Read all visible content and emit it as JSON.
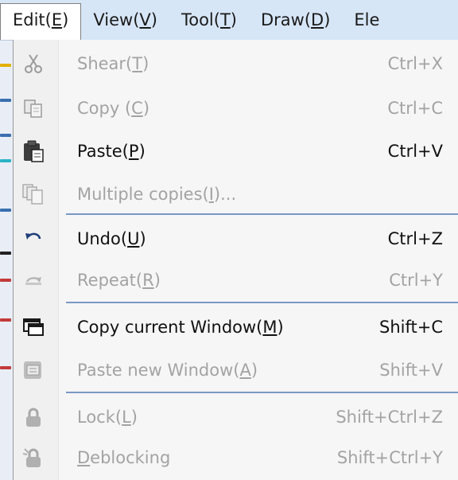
{
  "menubar": {
    "items": [
      {
        "text": "Edit(",
        "acc": "E",
        "tail": ")"
      },
      {
        "text": "View(",
        "acc": "V",
        "tail": ")"
      },
      {
        "text": "Tool(",
        "acc": "T",
        "tail": ")"
      },
      {
        "text": "Draw(",
        "acc": "D",
        "tail": ")"
      },
      {
        "text": "Ele",
        "acc": "",
        "tail": ""
      }
    ]
  },
  "menu": {
    "items": [
      {
        "pre": "Shear(",
        "acc": "T",
        "post": ")",
        "shortcut": "Ctrl+X",
        "enabled": false,
        "icon": "scissors-icon"
      },
      {
        "pre": "Copy (",
        "acc": "C",
        "post": ")",
        "shortcut": "Ctrl+C",
        "enabled": false,
        "icon": "copy-icon"
      },
      {
        "pre": "Paste(",
        "acc": "P",
        "post": ")",
        "shortcut": "Ctrl+V",
        "enabled": true,
        "icon": "clipboard-icon"
      },
      {
        "pre": "Multiple copies(",
        "acc": "I",
        "post": ")...",
        "shortcut": "",
        "enabled": false,
        "icon": "multi-copy-icon"
      },
      {
        "pre": "Undo(",
        "acc": "U",
        "post": ")",
        "shortcut": "Ctrl+Z",
        "enabled": true,
        "icon": "undo-icon"
      },
      {
        "pre": "Repeat(",
        "acc": "R",
        "post": ")",
        "shortcut": "Ctrl+Y",
        "enabled": false,
        "icon": "redo-icon"
      },
      {
        "pre": "Copy current Window(",
        "acc": "M",
        "post": ")",
        "shortcut": "Shift+C",
        "enabled": true,
        "icon": "copy-window-icon"
      },
      {
        "pre": "Paste new Window(",
        "acc": "A",
        "post": ")",
        "shortcut": "Shift+V",
        "enabled": false,
        "icon": "paste-window-icon"
      },
      {
        "pre": "Lock(",
        "acc": "L",
        "post": ")",
        "shortcut": "Shift+Ctrl+Z",
        "enabled": false,
        "icon": "lock-icon"
      },
      {
        "pre": "",
        "acc": "D",
        "post": "eblocking",
        "shortcut": "Shift+Ctrl+Y",
        "enabled": false,
        "icon": "unlock-icon"
      }
    ]
  },
  "colors": {
    "menubar_bg": "#d7e6f7",
    "separator": "#7a98c4",
    "disabled_text": "#a3a3a3"
  }
}
